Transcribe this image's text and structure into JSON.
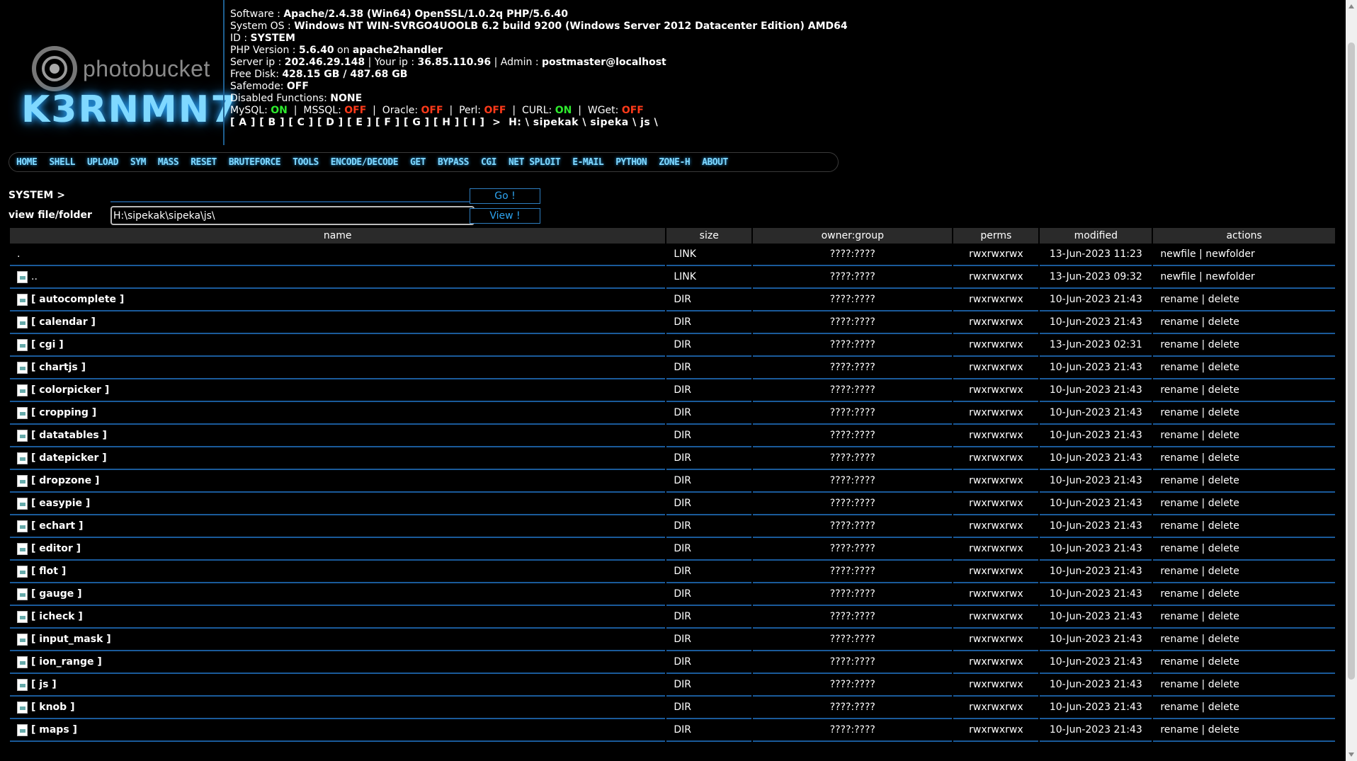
{
  "logo": {
    "watermark": "photobucket",
    "brand": "K3RNMN7"
  },
  "info": {
    "software_label": "Software : ",
    "software": "Apache/2.4.38 (Win64) OpenSSL/1.0.2q PHP/5.6.40",
    "os_label": "System OS : ",
    "os": "Windows NT WIN-SVRGO4UOOLB 6.2 build 9200 (Windows Server 2012 Datacenter Edition) AMD64",
    "id_label": "ID : ",
    "id": "SYSTEM",
    "php_label": "PHP Version : ",
    "php": "5.6.40",
    "php_on": " on ",
    "php_handler": "apache2handler",
    "server_ip_label": "Server ip : ",
    "server_ip": "202.46.29.148",
    "sep": " | ",
    "your_ip_label": "Your ip : ",
    "your_ip": "36.85.110.96",
    "admin_label": "Admin : ",
    "admin": "postmaster@localhost",
    "disk_label": "Free Disk: ",
    "disk": "428.15 GB / 487.68 GB",
    "safemode_label": "Safemode: ",
    "safemode": "OFF",
    "disabled_label": "Disabled Functions: ",
    "disabled": "NONE",
    "mysql_label": "MySQL: ",
    "mysql": "ON",
    "mssql_label": "  |  MSSQL: ",
    "mssql": "OFF",
    "oracle_label": "  |  Oracle: ",
    "oracle": "OFF",
    "perl_label": "  |  Perl: ",
    "perl": "OFF",
    "curl_label": "  |  CURL: ",
    "curl": "ON",
    "wget_label": "  |  WGet: ",
    "wget": "OFF",
    "drives": "[ A ] [ B ] [ C ] [ D ] [ E ] [ F ] [ G ] [ H ] [ I ]  >  H: \\ sipekak \\ sipeka \\ js \\"
  },
  "nav": [
    "HOME",
    "SHELL",
    "UPLOAD",
    "SYM",
    "MASS",
    "RESET",
    "BRUTEFORCE",
    "TOOLS",
    "ENCODE/DECODE",
    "GET",
    "BYPASS",
    "CGI",
    "NET SPLOIT",
    "E-MAIL",
    "PYTHON",
    "ZONE-H",
    "ABOUT"
  ],
  "form": {
    "cmd_label": "SYSTEM >",
    "cmd_value": "",
    "go_label": "Go !",
    "view_label": "view file/folder",
    "path_value": "H:\\sipekak\\sipeka\\js\\",
    "view_button": "View !"
  },
  "table": {
    "headers": [
      "name",
      "size",
      "owner:group",
      "perms",
      "modified",
      "actions"
    ],
    "rows": [
      {
        "name": ".",
        "size": "LINK",
        "owner": "????:????",
        "perms": "rwxrwxrwx",
        "modified": "13-Jun-2023 11:23",
        "a1": "newfile",
        "a2": "newfolder"
      },
      {
        "name": "..",
        "size": "LINK",
        "owner": "????:????",
        "perms": "rwxrwxrwx",
        "modified": "13-Jun-2023 09:32",
        "a1": "newfile",
        "a2": "newfolder"
      },
      {
        "name": "[ autocomplete ]",
        "size": "DIR",
        "owner": "????:????",
        "perms": "rwxrwxrwx",
        "modified": "10-Jun-2023 21:43",
        "a1": "rename",
        "a2": "delete"
      },
      {
        "name": "[ calendar ]",
        "size": "DIR",
        "owner": "????:????",
        "perms": "rwxrwxrwx",
        "modified": "10-Jun-2023 21:43",
        "a1": "rename",
        "a2": "delete"
      },
      {
        "name": "[ cgi ]",
        "size": "DIR",
        "owner": "????:????",
        "perms": "rwxrwxrwx",
        "modified": "13-Jun-2023 02:31",
        "a1": "rename",
        "a2": "delete"
      },
      {
        "name": "[ chartjs ]",
        "size": "DIR",
        "owner": "????:????",
        "perms": "rwxrwxrwx",
        "modified": "10-Jun-2023 21:43",
        "a1": "rename",
        "a2": "delete"
      },
      {
        "name": "[ colorpicker ]",
        "size": "DIR",
        "owner": "????:????",
        "perms": "rwxrwxrwx",
        "modified": "10-Jun-2023 21:43",
        "a1": "rename",
        "a2": "delete"
      },
      {
        "name": "[ cropping ]",
        "size": "DIR",
        "owner": "????:????",
        "perms": "rwxrwxrwx",
        "modified": "10-Jun-2023 21:43",
        "a1": "rename",
        "a2": "delete"
      },
      {
        "name": "[ datatables ]",
        "size": "DIR",
        "owner": "????:????",
        "perms": "rwxrwxrwx",
        "modified": "10-Jun-2023 21:43",
        "a1": "rename",
        "a2": "delete"
      },
      {
        "name": "[ datepicker ]",
        "size": "DIR",
        "owner": "????:????",
        "perms": "rwxrwxrwx",
        "modified": "10-Jun-2023 21:43",
        "a1": "rename",
        "a2": "delete"
      },
      {
        "name": "[ dropzone ]",
        "size": "DIR",
        "owner": "????:????",
        "perms": "rwxrwxrwx",
        "modified": "10-Jun-2023 21:43",
        "a1": "rename",
        "a2": "delete"
      },
      {
        "name": "[ easypie ]",
        "size": "DIR",
        "owner": "????:????",
        "perms": "rwxrwxrwx",
        "modified": "10-Jun-2023 21:43",
        "a1": "rename",
        "a2": "delete"
      },
      {
        "name": "[ echart ]",
        "size": "DIR",
        "owner": "????:????",
        "perms": "rwxrwxrwx",
        "modified": "10-Jun-2023 21:43",
        "a1": "rename",
        "a2": "delete"
      },
      {
        "name": "[ editor ]",
        "size": "DIR",
        "owner": "????:????",
        "perms": "rwxrwxrwx",
        "modified": "10-Jun-2023 21:43",
        "a1": "rename",
        "a2": "delete"
      },
      {
        "name": "[ flot ]",
        "size": "DIR",
        "owner": "????:????",
        "perms": "rwxrwxrwx",
        "modified": "10-Jun-2023 21:43",
        "a1": "rename",
        "a2": "delete"
      },
      {
        "name": "[ gauge ]",
        "size": "DIR",
        "owner": "????:????",
        "perms": "rwxrwxrwx",
        "modified": "10-Jun-2023 21:43",
        "a1": "rename",
        "a2": "delete"
      },
      {
        "name": "[ icheck ]",
        "size": "DIR",
        "owner": "????:????",
        "perms": "rwxrwxrwx",
        "modified": "10-Jun-2023 21:43",
        "a1": "rename",
        "a2": "delete"
      },
      {
        "name": "[ input_mask ]",
        "size": "DIR",
        "owner": "????:????",
        "perms": "rwxrwxrwx",
        "modified": "10-Jun-2023 21:43",
        "a1": "rename",
        "a2": "delete"
      },
      {
        "name": "[ ion_range ]",
        "size": "DIR",
        "owner": "????:????",
        "perms": "rwxrwxrwx",
        "modified": "10-Jun-2023 21:43",
        "a1": "rename",
        "a2": "delete"
      },
      {
        "name": "[ js ]",
        "size": "DIR",
        "owner": "????:????",
        "perms": "rwxrwxrwx",
        "modified": "10-Jun-2023 21:43",
        "a1": "rename",
        "a2": "delete"
      },
      {
        "name": "[ knob ]",
        "size": "DIR",
        "owner": "????:????",
        "perms": "rwxrwxrwx",
        "modified": "10-Jun-2023 21:43",
        "a1": "rename",
        "a2": "delete"
      },
      {
        "name": "[ maps ]",
        "size": "DIR",
        "owner": "????:????",
        "perms": "rwxrwxrwx",
        "modified": "10-Jun-2023 21:43",
        "a1": "rename",
        "a2": "delete"
      }
    ]
  },
  "colors": {
    "on": "#2eea2e",
    "off": "#ff3a1a",
    "accent": "#7fd8ff",
    "row_border": "#1a5a9a"
  }
}
